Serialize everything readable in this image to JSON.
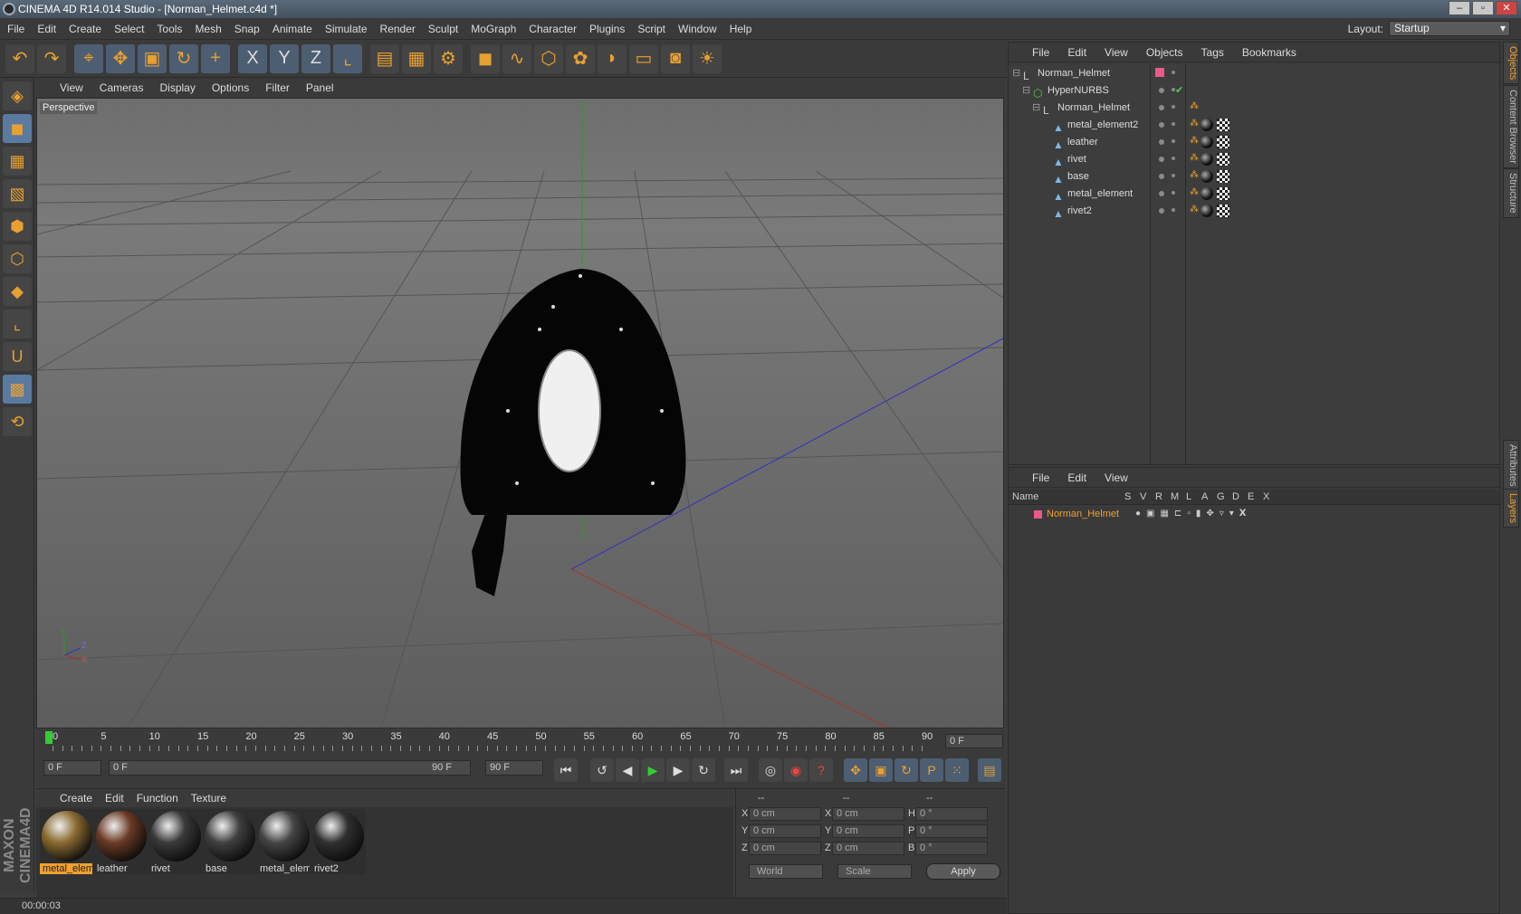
{
  "window": {
    "title": "CINEMA 4D R14.014 Studio - [Norman_Helmet.c4d *]"
  },
  "menu": [
    "File",
    "Edit",
    "Create",
    "Select",
    "Tools",
    "Mesh",
    "Snap",
    "Animate",
    "Simulate",
    "Render",
    "Sculpt",
    "MoGraph",
    "Character",
    "Plugins",
    "Script",
    "Window",
    "Help"
  ],
  "layout": {
    "label": "Layout:",
    "value": "Startup"
  },
  "toolbar_icons": [
    "undo-icon",
    "redo-icon",
    "live-select-icon",
    "move-icon",
    "scale-icon",
    "rotate-icon",
    "add-icon",
    "x-axis-icon",
    "y-axis-icon",
    "z-axis-icon",
    "coordinate-system-icon",
    "render-view-icon",
    "render-picture-icon",
    "render-settings-icon",
    "cube-icon",
    "spline-icon",
    "nurbs-icon",
    "array-icon",
    "deformer-icon",
    "floor-icon",
    "camera-icon",
    "light-icon"
  ],
  "left_tools": [
    "make-editable-icon",
    "model-mode-icon",
    "texture-mode-icon",
    "workplane-icon",
    "points-mode-icon",
    "edges-mode-icon",
    "polygons-mode-icon",
    "axis-icon",
    "magnet-icon",
    "snap-icon",
    "locked-workplane-icon"
  ],
  "viewport": {
    "menu": [
      "View",
      "Cameras",
      "Display",
      "Options",
      "Filter",
      "Panel"
    ],
    "label": "Perspective",
    "axis_labels": {
      "y": "Y",
      "z": "Z",
      "x": "X"
    }
  },
  "timeline": {
    "ticks": [
      "0",
      "5",
      "10",
      "15",
      "20",
      "25",
      "30",
      "35",
      "40",
      "45",
      "50",
      "55",
      "60",
      "65",
      "70",
      "75",
      "80",
      "85",
      "90"
    ],
    "current_frame": "0 F"
  },
  "transport": {
    "start": "0 F",
    "range_start": "0 F",
    "range_end": "90 F",
    "end": "90 F"
  },
  "materials": {
    "menu": [
      "Create",
      "Edit",
      "Function",
      "Texture"
    ],
    "items": [
      {
        "name": "metal_elem",
        "color": "#8a6a30",
        "selected": true
      },
      {
        "name": "leather",
        "color": "#6a3a25",
        "selected": false
      },
      {
        "name": "rivet",
        "color": "#3a3a3a",
        "selected": false
      },
      {
        "name": "base",
        "color": "#404040",
        "selected": false
      },
      {
        "name": "metal_elem",
        "color": "#454545",
        "selected": false
      },
      {
        "name": "rivet2",
        "color": "#303030",
        "selected": false
      }
    ]
  },
  "coords": {
    "headers": [
      "--",
      "--",
      "--"
    ],
    "rows": [
      {
        "a": "X",
        "av": "0 cm",
        "b": "X",
        "bv": "0 cm",
        "c": "H",
        "cv": "0 °"
      },
      {
        "a": "Y",
        "av": "0 cm",
        "b": "Y",
        "bv": "0 cm",
        "c": "P",
        "cv": "0 °"
      },
      {
        "a": "Z",
        "av": "0 cm",
        "b": "Z",
        "bv": "0 cm",
        "c": "B",
        "cv": "0 °"
      }
    ],
    "mode": "World",
    "size_mode": "Scale",
    "apply": "Apply"
  },
  "status": {
    "time": "00:00:03"
  },
  "brand": "MAXON CINEMA4D",
  "objects": {
    "menu": [
      "File",
      "Edit",
      "View",
      "Objects",
      "Tags",
      "Bookmarks"
    ],
    "tree": [
      {
        "name": "Norman_Helmet",
        "indent": 0
      },
      {
        "name": "HyperNURBS",
        "indent": 1
      },
      {
        "name": "Norman_Helmet",
        "indent": 2
      },
      {
        "name": "metal_element2",
        "indent": 3
      },
      {
        "name": "leather",
        "indent": 3
      },
      {
        "name": "rivet",
        "indent": 3
      },
      {
        "name": "base",
        "indent": 3
      },
      {
        "name": "metal_element",
        "indent": 3
      },
      {
        "name": "rivet2",
        "indent": 3
      }
    ]
  },
  "layers": {
    "menu": [
      "File",
      "Edit",
      "View"
    ],
    "columns": [
      "Name",
      "S",
      "V",
      "R",
      "M",
      "L",
      "A",
      "G",
      "D",
      "E",
      "X"
    ],
    "rows": [
      {
        "name": "Norman_Helmet",
        "color": "#e85a8a"
      }
    ]
  },
  "right_tabs": [
    "Objects",
    "Content Browser",
    "Structure",
    "Attributes",
    "Layers"
  ]
}
